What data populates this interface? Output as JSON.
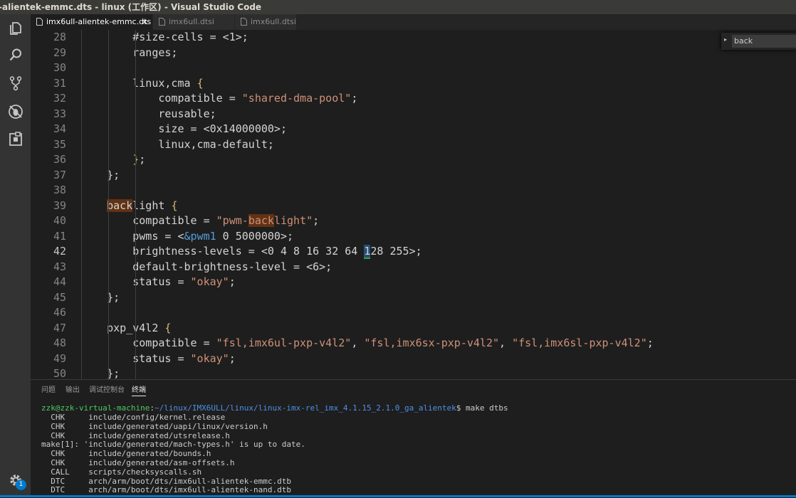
{
  "window": {
    "title": "-alientek-emmc.dts - linux (工作区) - Visual Studio Code"
  },
  "tabs": [
    {
      "label": "imx6ull-alientek-emmc.dts",
      "close": "×",
      "active": true
    },
    {
      "label": "imx6ull.dtsi",
      "active": false
    },
    {
      "label": "imx6ull.dtsi",
      "active": false
    }
  ],
  "find": {
    "arrow": "▸",
    "value": "back"
  },
  "editor": {
    "current_line": 42,
    "lines": [
      {
        "n": "28",
        "segs": [
          {
            "t": "        #size-cells = <1>;"
          }
        ]
      },
      {
        "n": "29",
        "segs": [
          {
            "t": "        ranges;"
          }
        ]
      },
      {
        "n": "30",
        "segs": [
          {
            "t": ""
          }
        ]
      },
      {
        "n": "31",
        "segs": [
          {
            "t": "        linux,cma "
          },
          {
            "t": "{",
            "c": "t-br"
          }
        ]
      },
      {
        "n": "32",
        "segs": [
          {
            "t": "            compatible = "
          },
          {
            "t": "\"shared-dma-pool\"",
            "c": "t-str"
          },
          {
            "t": ";"
          }
        ]
      },
      {
        "n": "33",
        "segs": [
          {
            "t": "            reusable;"
          }
        ]
      },
      {
        "n": "34",
        "segs": [
          {
            "t": "            size = <0x14000000>;"
          }
        ]
      },
      {
        "n": "35",
        "segs": [
          {
            "t": "            linux,cma-default;"
          }
        ]
      },
      {
        "n": "36",
        "segs": [
          {
            "t": "        "
          },
          {
            "t": "}",
            "c": "t-br"
          },
          {
            "t": ";"
          }
        ]
      },
      {
        "n": "37",
        "segs": [
          {
            "t": "    };"
          }
        ]
      },
      {
        "n": "38",
        "segs": [
          {
            "t": ""
          }
        ]
      },
      {
        "n": "39",
        "segs": [
          {
            "t": "    "
          },
          {
            "t": "back",
            "c": "hl-match"
          },
          {
            "t": "light "
          },
          {
            "t": "{",
            "c": "t-br"
          }
        ]
      },
      {
        "n": "40",
        "segs": [
          {
            "t": "        compatible = "
          },
          {
            "t": "\"pwm-",
            "c": "t-str"
          },
          {
            "t": "back",
            "c": "t-str hl-match"
          },
          {
            "t": "light\"",
            "c": "t-str"
          },
          {
            "t": ";"
          }
        ]
      },
      {
        "n": "41",
        "segs": [
          {
            "t": "        pwms = <"
          },
          {
            "t": "&pwm1",
            "c": "t-blue"
          },
          {
            "t": " 0 5000000>;"
          }
        ]
      },
      {
        "n": "42",
        "segs": [
          {
            "t": "        brightness-levels = <0 4 8 16 32 64 "
          },
          {
            "t": "1",
            "c": "hl-cursor"
          },
          {
            "t": "28 255>;"
          }
        ]
      },
      {
        "n": "43",
        "segs": [
          {
            "t": "        default-brightness-level = <6>;"
          }
        ]
      },
      {
        "n": "44",
        "segs": [
          {
            "t": "        status = "
          },
          {
            "t": "\"okay\"",
            "c": "t-str"
          },
          {
            "t": ";"
          }
        ]
      },
      {
        "n": "45",
        "segs": [
          {
            "t": "    };"
          }
        ]
      },
      {
        "n": "46",
        "segs": [
          {
            "t": ""
          }
        ]
      },
      {
        "n": "47",
        "segs": [
          {
            "t": "    pxp_v4l2 "
          },
          {
            "t": "{",
            "c": "t-br"
          }
        ]
      },
      {
        "n": "48",
        "segs": [
          {
            "t": "        compatible = "
          },
          {
            "t": "\"fsl,imx6ul-pxp-v4l2\"",
            "c": "t-str"
          },
          {
            "t": ", "
          },
          {
            "t": "\"fsl,imx6sx-pxp-v4l2\"",
            "c": "t-str"
          },
          {
            "t": ", "
          },
          {
            "t": "\"fsl,imx6sl-pxp-v4l2\"",
            "c": "t-str"
          },
          {
            "t": ";"
          }
        ]
      },
      {
        "n": "49",
        "segs": [
          {
            "t": "        status = "
          },
          {
            "t": "\"okay\"",
            "c": "t-str"
          },
          {
            "t": ";"
          }
        ]
      },
      {
        "n": "50",
        "segs": [
          {
            "t": "    };"
          }
        ]
      }
    ]
  },
  "panel": {
    "tabs": [
      "问题",
      "输出",
      "调试控制台",
      "终端"
    ],
    "active_tab": 3,
    "prompt": {
      "user": "zzk@zzk-virtual-machine",
      "sep": ":",
      "path": "~/linux/IMX6ULL/linux/linux-imx-rel_imx_4.1.15_2.1.0_ga_alientek",
      "cmd": "$ make dtbs"
    },
    "lines": [
      "  CHK     include/config/kernel.release",
      "  CHK     include/generated/uapi/linux/version.h",
      "  CHK     include/generated/utsrelease.h",
      "make[1]: 'include/generated/mach-types.h' is up to date.",
      "  CHK     include/generated/bounds.h",
      "  CHK     include/generated/asm-offsets.h",
      "  CALL    scripts/checksyscalls.sh",
      "  DTC     arch/arm/boot/dts/imx6ull-alientek-emmc.dtb",
      "  DTC     arch/arm/boot/dts/imx6ull-alientek-nand.dtb"
    ]
  },
  "activity": {
    "icons": [
      "files-icon",
      "search-icon",
      "source-control-icon",
      "debug-icon",
      "extensions-icon"
    ],
    "settings_badge": "1"
  },
  "colors": {
    "accent": "#007acc",
    "string": "#ce9178",
    "match": "#613214",
    "keyword": "#569cd6"
  }
}
